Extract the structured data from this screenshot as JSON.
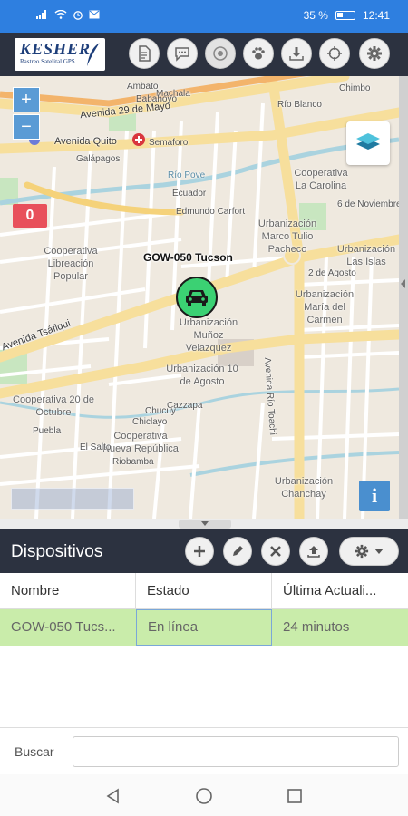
{
  "status_bar": {
    "signal": "35 %",
    "time": "12:41"
  },
  "toolbar": {
    "logo_text": "KESHER",
    "logo_sub": "Rastreo Satelital GPS",
    "buttons": [
      "report-icon",
      "chat-icon",
      "target-icon",
      "paw-icon",
      "download-icon",
      "crosshair-icon",
      "gear-icon"
    ]
  },
  "map": {
    "zoom_in": "+",
    "zoom_out": "−",
    "alert_count": "0",
    "vehicle_label": "GOW-050 Tucson",
    "info": "i",
    "labels": {
      "av_29_mayo": "Avenida 29 de Mayo",
      "av_quito": "Avenida Quito",
      "semaforo": "Semaforo",
      "galapagos": "Galápagos",
      "rio_pove": "Río Pove",
      "coop_la_carolina": "Cooperativa La Carolina",
      "nov6": "6 de Noviembre",
      "urb_marco": "Urbanización Marco Tulio Pacheco",
      "coop_libreacion": "Cooperativa Libreación Popular",
      "urb_las_islas": "Urbanización Las Islas",
      "urb_maria": "Urbanización María del Carmen",
      "av_tsafiqui": "Avenida Tsáfiqui",
      "urb_munoz": "Urbanización Muñoz Velazquez",
      "av_rio_toachi": "Avenida Río Toachi",
      "urb_10_agosto": "Urbanización 10 de Agosto",
      "coop_20_octubre": "Cooperativa 20 de Octubre",
      "coop_nueva": "Cooperativa Nueva República",
      "urb_chanchay": "Urbanización Chanchay",
      "chiclayo": "Chiclayo",
      "cazzapa": "Cazzapa",
      "chucuy": "Chucuy",
      "ambato": "Ambato",
      "machala": "Machala",
      "babahoyo": "Babahoyo",
      "rio_blanco": "Río Blanco",
      "chimbo": "Chimbo",
      "edmundo": "Edmundo Carfort",
      "ecuador": "Ecuador",
      "el_salto": "El Salto",
      "riobamba": "Riobamba",
      "puebla": "Puebla",
      "agosto_2": "2 de Agosto"
    }
  },
  "devices": {
    "title": "Dispositivos",
    "columns": [
      "Nombre",
      "Estado",
      "Última Actuali..."
    ],
    "rows": [
      {
        "nombre": "GOW-050 Tucs...",
        "estado": "En línea",
        "actualizacion": "24 minutos"
      }
    ]
  },
  "search": {
    "label": "Buscar",
    "value": "",
    "placeholder": ""
  },
  "colors": {
    "status_bar": "#2e7fe0",
    "toolbar": "#2c3240",
    "row_highlight": "#c9ecaa",
    "marker": "#3bd173",
    "alert": "#e8505b"
  }
}
